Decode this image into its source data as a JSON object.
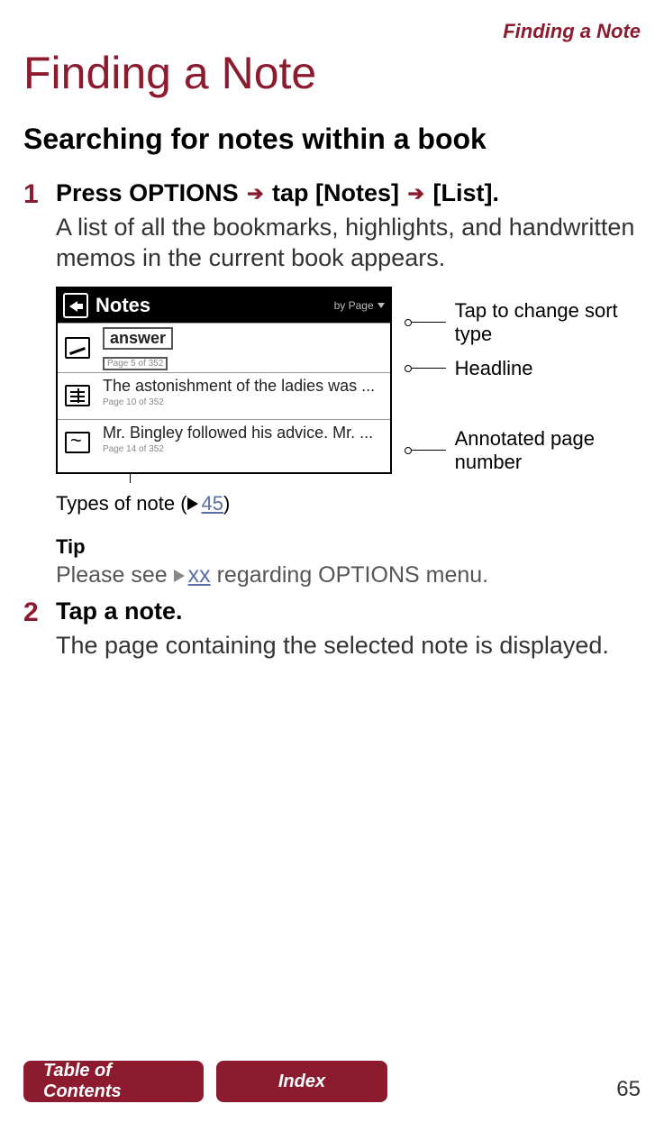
{
  "running_head": "Finding a Note",
  "title": "Finding a Note",
  "subtitle": "Searching for notes within a book",
  "steps": [
    {
      "num": "1",
      "head_before": "Press OPTIONS ",
      "head_mid": " tap [Notes] ",
      "head_after": " [List].",
      "desc": "A list of all the bookmarks, highlights, and handwritten memos in the current book appears."
    },
    {
      "num": "2",
      "head_before": "Tap a note.",
      "head_mid": "",
      "head_after": "",
      "desc": "The page containing the selected note is displayed."
    }
  ],
  "screenshot": {
    "title": "Notes",
    "sort_label": "by Page",
    "rows": [
      {
        "title": "answer",
        "page": "Page 5 of 352",
        "boxed_title": true,
        "boxed_page": true
      },
      {
        "title": "The astonishment of the ladies was ...",
        "page": "Page 10 of 352",
        "boxed_title": false,
        "boxed_page": false
      },
      {
        "title": "Mr. Bingley followed his advice. Mr. ...",
        "page": "Page 14 of 352",
        "boxed_title": false,
        "boxed_page": false
      }
    ]
  },
  "callouts": {
    "sort": "Tap to change sort type",
    "headline": "Headline",
    "pagenum": "Annotated page number",
    "types_prefix": "Types of note (",
    "types_link": "45",
    "types_suffix": ")"
  },
  "tip": {
    "head": "Tip",
    "before": "Please see ",
    "link": "xx",
    "after": " regarding OPTIONS menu."
  },
  "footer": {
    "toc": "Table of Contents",
    "index": "Index",
    "page": "65"
  }
}
